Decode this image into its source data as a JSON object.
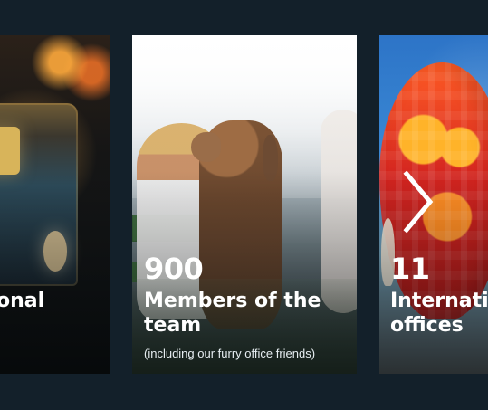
{
  "cards": [
    {
      "id": "left",
      "headline": "onal"
    },
    {
      "id": "center",
      "number": "900",
      "headline_line1": "Members of the",
      "headline_line2": "team",
      "subtext": "(including our furry office friends)"
    },
    {
      "id": "right",
      "number": "11",
      "headline_line1": "Internati",
      "headline_line2": "offices"
    }
  ],
  "navigation": {
    "next_icon": "chevron-right-icon"
  }
}
